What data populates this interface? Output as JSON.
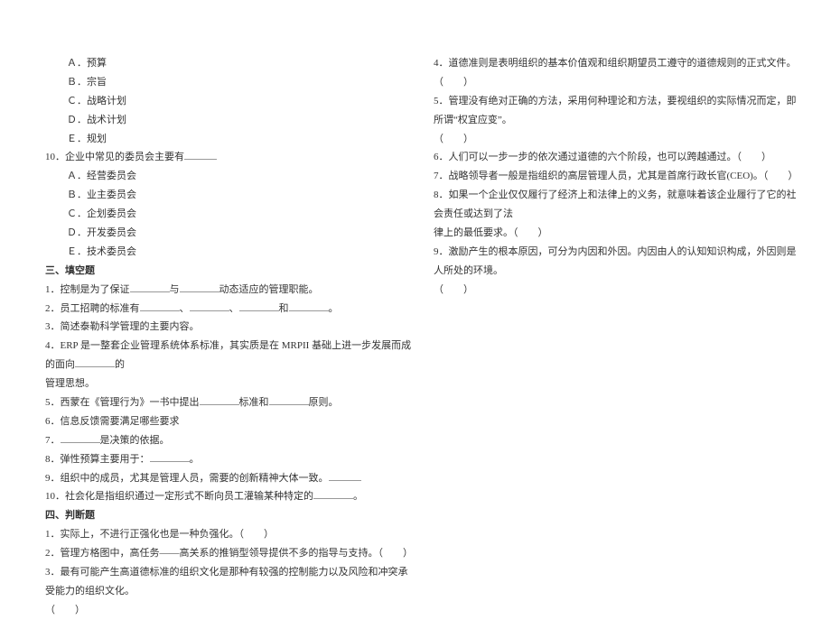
{
  "left": {
    "q9_options": [
      "Ａ．预算",
      "Ｂ．宗旨",
      "Ｃ．战略计划",
      "Ｄ．战术计划",
      "Ｅ．规划"
    ],
    "q10_stem": "10．企业中常见的委员会主要有",
    "q10_options": [
      "Ａ．经营委员会",
      "Ｂ．业主委员会",
      "Ｃ．企划委员会",
      "Ｄ．开发委员会",
      "Ｅ．技术委员会"
    ],
    "section3": "三、填空题",
    "fill": {
      "f1a": "1．控制是为了保证",
      "f1b": "与",
      "f1c": "动态适应的管理职能。",
      "f2a": "2．员工招聘的标准有",
      "f2b": "、",
      "f2c": "、",
      "f2d": "和",
      "f2e": "。",
      "f3": "3．简述泰勒科学管理的主要内容。",
      "f4a": "4．ERP 是一整套企业管理系统体系标准，其实质是在 MRPII 基础上进一步发展而成的面向",
      "f4b": "的",
      "f4c": "管理思想。",
      "f5a": "5．西蒙在《管理行为》一书中提出",
      "f5b": "标准和",
      "f5c": "原则。",
      "f6": "6．信息反馈需要满足哪些要求",
      "f7a": "7．",
      "f7b": "是决策的依据。",
      "f8a": "8．弹性预算主要用于：",
      "f8b": "。",
      "f9a": "9．组织中的成员，尤其是管理人员，需要的创新精神大体一致。",
      "f10a": "10．社会化是指组织通过一定形式不断向员工灌输某种特定的",
      "f10b": "。"
    },
    "section4": "四、判断题",
    "judge_left": {
      "j1": "1．实际上，不进行正强化也是一种负强化。（　　）",
      "j2": "2．管理方格图中，高任务——高关系的推销型领导提供不多的指导与支持。（　　）",
      "j3a": "3．最有可能产生高道德标准的组织文化是那种有较强的控制能力以及风险和冲突承受能力的组织文化。",
      "j3b": "（　　）"
    }
  },
  "right": {
    "j4": "4．道德准则是表明组织的基本价值观和组织期望员工遵守的道德规则的正式文件。（　　）",
    "j5a": "5．管理没有绝对正确的方法，采用何种理论和方法，要视组织的实际情况而定，即所谓“权宜应变”。",
    "j5b": "（　　）",
    "j6": "6．人们可以一步一步的依次通过道德的六个阶段，也可以跨越通过。（　　）",
    "j7": "7．战略领导者一般是指组织的高层管理人员，尤其是首席行政长官(CEO)。（　　）",
    "j8a": "8．如果一个企业仅仅履行了经济上和法律上的义务，就意味着该企业履行了它的社会责任或达到了法",
    "j8b": "律上的最低要求。（　　）",
    "j9a": "9．激励产生的根本原因，可分为内因和外因。内因由人的认知知识构成，外因则是人所处的环境。",
    "j9b": "（　　）"
  }
}
